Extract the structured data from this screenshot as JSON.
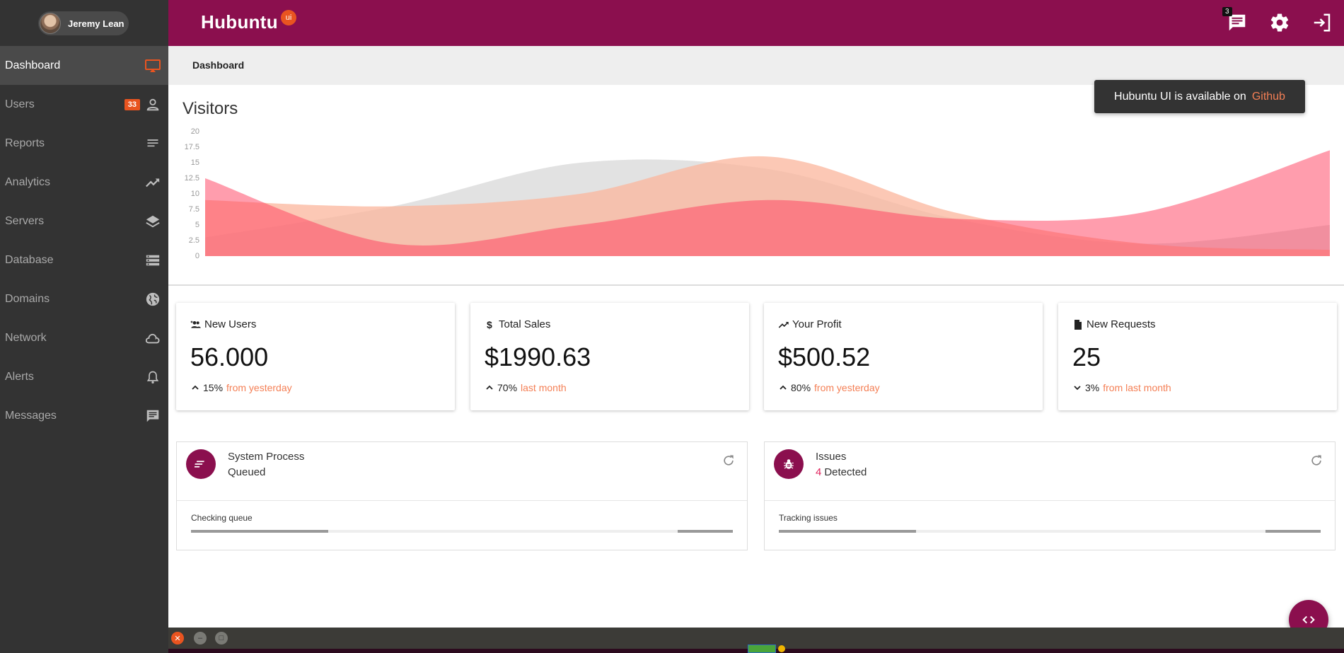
{
  "user": {
    "name": "Jeremy Lean"
  },
  "sidebar": {
    "items": [
      {
        "label": "Dashboard",
        "icon": "monitor-icon",
        "active": true
      },
      {
        "label": "Users",
        "icon": "user-icon",
        "badge": "33"
      },
      {
        "label": "Reports",
        "icon": "lines-icon"
      },
      {
        "label": "Analytics",
        "icon": "trending-up-icon"
      },
      {
        "label": "Servers",
        "icon": "layers-icon"
      },
      {
        "label": "Database",
        "icon": "database-icon"
      },
      {
        "label": "Domains",
        "icon": "globe-icon"
      },
      {
        "label": "Network",
        "icon": "cloud-icon"
      },
      {
        "label": "Alerts",
        "icon": "bell-icon"
      },
      {
        "label": "Messages",
        "icon": "chat-icon"
      }
    ]
  },
  "topbar": {
    "brand": "Hubuntu",
    "brand_suffix": "ui",
    "messages_count": "3",
    "colors": {
      "primary": "#8b0f4e",
      "accent": "#e95420"
    }
  },
  "breadcrumb": {
    "current": "Dashboard"
  },
  "toast": {
    "text": "Hubuntu UI is available on",
    "link": "Github"
  },
  "visitors": {
    "title": "Visitors"
  },
  "chart_data": {
    "type": "area",
    "title": "Visitors",
    "ylim": [
      0,
      20
    ],
    "yticks": [
      "0",
      "2.5",
      "5",
      "7.5",
      "10",
      "12.5",
      "15",
      "17.5",
      "20"
    ],
    "x": [
      0,
      1,
      2,
      3,
      4,
      5,
      6
    ],
    "series": [
      {
        "color": "#d8d8d8",
        "values": [
          3,
          8,
          15,
          14,
          6,
          2,
          5
        ]
      },
      {
        "color": "#fbb59c",
        "values": [
          9,
          8,
          10,
          16,
          7,
          2,
          1
        ]
      },
      {
        "color": "#ff3b5c",
        "values": [
          12.5,
          2,
          5,
          9,
          6,
          7,
          17
        ]
      }
    ]
  },
  "stats": [
    {
      "label": "New Users",
      "icon": "group-add-icon",
      "value": "56.000",
      "percent": "15%",
      "trend": "up",
      "hint": "from yesterday"
    },
    {
      "label": "Total Sales",
      "icon": "dollar-icon",
      "value": "$1990.63",
      "percent": "70%",
      "trend": "up",
      "hint": "last month"
    },
    {
      "label": "Your Profit",
      "icon": "trending-up-icon",
      "value": "$500.52",
      "percent": "80%",
      "trend": "up",
      "hint": "from yesterday"
    },
    {
      "label": "New Requests",
      "icon": "file-icon",
      "value": "25",
      "percent": "3%",
      "trend": "down",
      "hint": "from last month"
    }
  ],
  "processes": [
    {
      "title": "System Process",
      "status": "Queued",
      "sub": "Checking queue",
      "icon": "lines-icon"
    },
    {
      "title": "Issues",
      "count": "4",
      "status": "Detected",
      "sub": "Tracking issues",
      "icon": "bug-icon"
    }
  ]
}
